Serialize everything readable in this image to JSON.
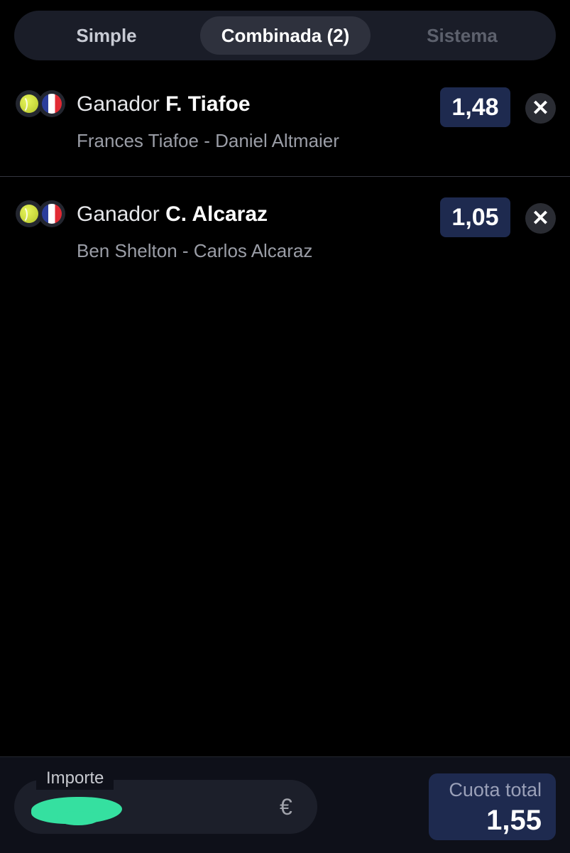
{
  "tabs": [
    {
      "label": "Simple"
    },
    {
      "label": "Combinada (2)"
    },
    {
      "label": "Sistema"
    }
  ],
  "bets": [
    {
      "prefix": "Ganador",
      "selection": "F. Tiafoe",
      "match": "Frances Tiafoe - Daniel Altmaier",
      "odds": "1,48",
      "sport_icon": "tennis-ball-icon",
      "flag_icon": "france-flag-icon"
    },
    {
      "prefix": "Ganador",
      "selection": "C. Alcaraz",
      "match": "Ben Shelton - Carlos Alcaraz",
      "odds": "1,05",
      "sport_icon": "tennis-ball-icon",
      "flag_icon": "france-flag-icon"
    }
  ],
  "close_symbol": "✕",
  "footer": {
    "amount_label": "Importe",
    "currency": "€",
    "total_label": "Cuota total",
    "total_value": "1,55"
  },
  "colors": {
    "background": "#000000",
    "odds_bg": "#1e2a4f",
    "tab_bar_bg": "#1a1d28",
    "redaction": "#35e0a0"
  }
}
